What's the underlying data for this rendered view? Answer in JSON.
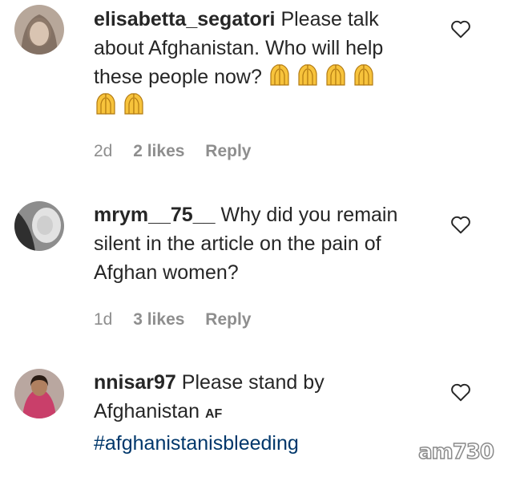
{
  "comments": [
    {
      "username": "elisabetta_segatori",
      "text": "Please talk about Afghanistan. Who will help these people now?",
      "emoji_name": "folded-hands-emoji",
      "emoji_count": 6,
      "time": "2d",
      "likes": "2 likes",
      "reply": "Reply"
    },
    {
      "username": "mrym__75__",
      "text": "Why did you remain silent in the article on the pain of Afghan women?",
      "time": "1d",
      "likes": "3 likes",
      "reply": "Reply"
    },
    {
      "username": "nnisar97",
      "text": "Please stand by Afghanistan",
      "flag": "AF",
      "hashtag": "#afghanistanisbleeding"
    }
  ],
  "icons": {
    "like": "heart-icon"
  },
  "watermark": "am730",
  "colors": {
    "text": "#262626",
    "meta": "#8e8e8e",
    "hashtag": "#00376b"
  }
}
